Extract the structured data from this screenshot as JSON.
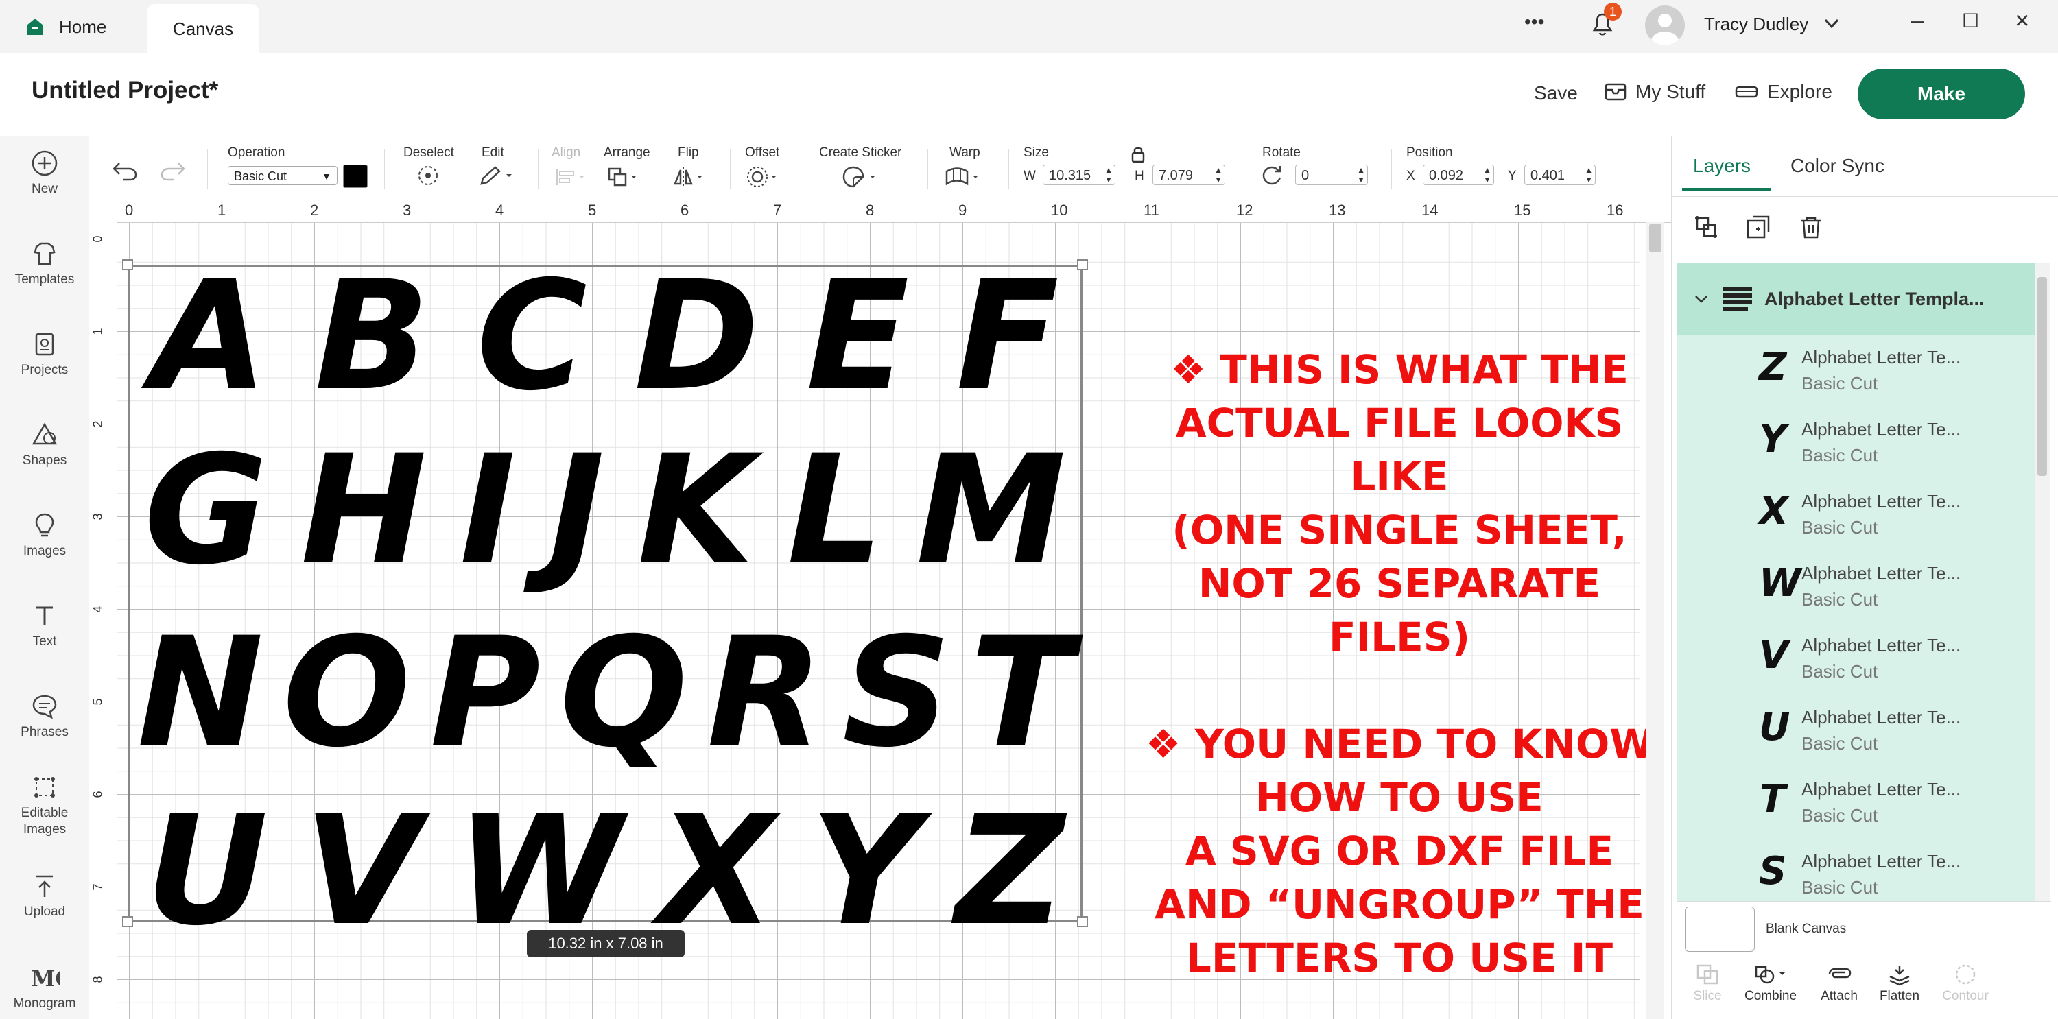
{
  "titlebar": {
    "home_tab": "Home",
    "canvas_tab": "Canvas",
    "more_glyph": "•••",
    "notification_count": "1",
    "user_name": "Tracy Dudley",
    "minimize_glyph": "─",
    "maximize_glyph": "☐",
    "close_glyph": "✕"
  },
  "header": {
    "project_title": "Untitled Project*",
    "save": "Save",
    "my_stuff": "My Stuff",
    "explore": "Explore",
    "make": "Make",
    "brand_color": "#0f7a53"
  },
  "sidebar": {
    "items": [
      {
        "label": "New",
        "icon": "plus-circle-icon",
        "glyph": "⊕"
      },
      {
        "label": "Templates",
        "icon": "shirt-icon",
        "glyph": "👕"
      },
      {
        "label": "Projects",
        "icon": "projects-icon",
        "glyph": "▣"
      },
      {
        "label": "Shapes",
        "icon": "shapes-icon",
        "glyph": "⬠"
      },
      {
        "label": "Images",
        "icon": "lightbulb-icon",
        "glyph": "💡"
      },
      {
        "label": "Text",
        "icon": "text-icon",
        "glyph": "T"
      },
      {
        "label": "Phrases",
        "icon": "speech-bubble-icon",
        "glyph": "💬"
      },
      {
        "label": "Editable Images",
        "icon": "editable-image-icon",
        "glyph": "⧉"
      },
      {
        "label": "Upload",
        "icon": "upload-icon",
        "glyph": "⤒"
      },
      {
        "label": "Monogram",
        "icon": "monogram-icon",
        "glyph": "M"
      }
    ]
  },
  "toolbar": {
    "undo_glyph": "↶",
    "redo_glyph": "↷",
    "operation_label": "Operation",
    "operation_value": "Basic Cut",
    "deselect": "Deselect",
    "edit": "Edit",
    "align": "Align",
    "arrange": "Arrange",
    "flip": "Flip",
    "offset": "Offset",
    "create_sticker": "Create Sticker",
    "warp": "Warp",
    "size": "Size",
    "w_label": "W",
    "w_value": "10.315",
    "h_label": "H",
    "h_value": "7.079",
    "rotate": "Rotate",
    "rotate_value": "0",
    "position": "Position",
    "x_label": "X",
    "x_value": "0.092",
    "y_label": "Y",
    "y_value": "0.401",
    "operation_color": "#000000"
  },
  "canvas": {
    "ruler_top": [
      "0",
      "1",
      "2",
      "3",
      "4",
      "5",
      "6",
      "7",
      "8",
      "9",
      "10",
      "11",
      "12",
      "13",
      "14",
      "15",
      "16"
    ],
    "ruler_left": [
      "0",
      "1",
      "2",
      "3",
      "4",
      "5",
      "6",
      "7",
      "8"
    ],
    "letter_rows": [
      "ABCDEF",
      "GHIJKLM",
      "NOPQRST",
      "UVWXYZ"
    ],
    "size_badge": "10.32  in x 7.08  in",
    "note_lines": [
      "❖ THIS IS WHAT THE",
      "ACTUAL FILE LOOKS LIKE",
      "(ONE SINGLE SHEET,",
      "NOT 26 SEPARATE FILES)",
      "",
      "❖ YOU NEED TO KNOW",
      "HOW TO USE",
      "A SVG OR DXF FILE",
      "AND “UNGROUP” THE",
      "LETTERS TO USE IT"
    ],
    "note_color": "#ef1010"
  },
  "panel": {
    "tabs": [
      "Layers",
      "Color Sync"
    ],
    "group_name": "Alphabet Letter Templa...",
    "layers": [
      {
        "glyph": "Z",
        "name": "Alphabet Letter Te...",
        "op": "Basic Cut"
      },
      {
        "glyph": "Y",
        "name": "Alphabet Letter Te...",
        "op": "Basic Cut"
      },
      {
        "glyph": "X",
        "name": "Alphabet Letter Te...",
        "op": "Basic Cut"
      },
      {
        "glyph": "W",
        "name": "Alphabet Letter Te...",
        "op": "Basic Cut"
      },
      {
        "glyph": "V",
        "name": "Alphabet Letter Te...",
        "op": "Basic Cut"
      },
      {
        "glyph": "U",
        "name": "Alphabet Letter Te...",
        "op": "Basic Cut"
      },
      {
        "glyph": "T",
        "name": "Alphabet Letter Te...",
        "op": "Basic Cut"
      },
      {
        "glyph": "S",
        "name": "Alphabet Letter Te...",
        "op": "Basic Cut"
      }
    ],
    "blank_canvas": "Blank Canvas",
    "bottom_tools": [
      {
        "label": "Slice",
        "enabled": false
      },
      {
        "label": "Combine",
        "enabled": true
      },
      {
        "label": "Attach",
        "enabled": true
      },
      {
        "label": "Flatten",
        "enabled": true
      },
      {
        "label": "Contour",
        "enabled": false
      }
    ]
  }
}
